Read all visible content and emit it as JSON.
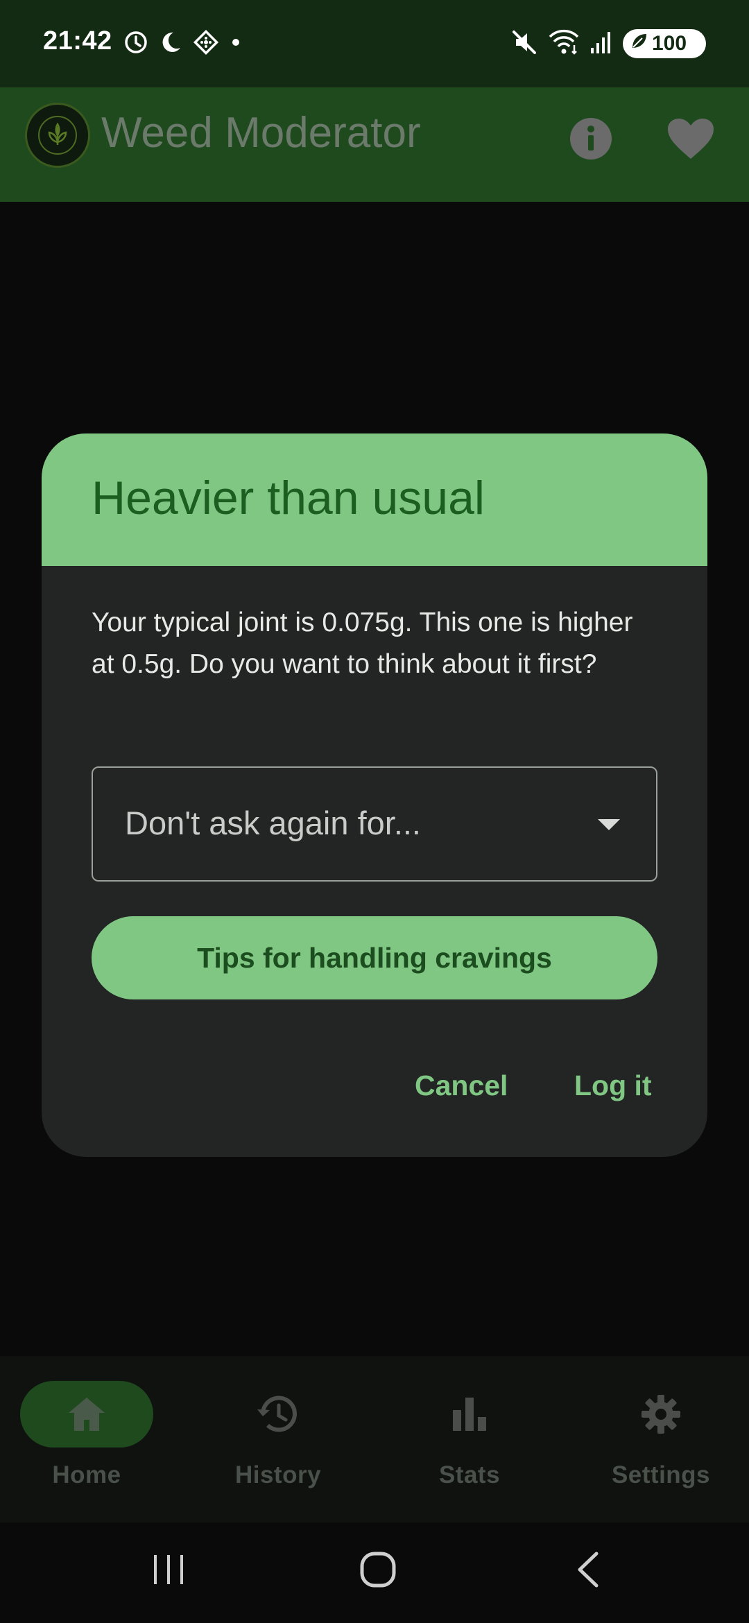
{
  "status_bar": {
    "time": "21:42",
    "battery": "100",
    "icons": [
      "alarm-icon",
      "do-not-disturb-moon-icon",
      "nfc-diamond-icon",
      "notification-dot-icon",
      "mute-icon",
      "wifi-icon",
      "signal-icon",
      "battery-saver-leaf-icon"
    ]
  },
  "app_bar": {
    "title": "Weed Moderator",
    "actions": [
      "info-icon",
      "heart-icon"
    ]
  },
  "dialog": {
    "title": "Heavier than usual",
    "message": "Your typical joint is 0.075g. This one is higher at 0.5g. Do you want to think about it first?",
    "dropdown_placeholder": "Don't ask again for...",
    "tips_button": "Tips for handling cravings",
    "cancel_button": "Cancel",
    "confirm_button": "Log it"
  },
  "bottom_nav": {
    "items": [
      {
        "label": "Home",
        "icon": "home-icon",
        "active": true
      },
      {
        "label": "History",
        "icon": "history-icon",
        "active": false
      },
      {
        "label": "Stats",
        "icon": "bar-chart-icon",
        "active": false
      },
      {
        "label": "Settings",
        "icon": "gear-icon",
        "active": false
      }
    ]
  },
  "colors": {
    "status_bar_bg": "#132b13",
    "app_bar_bg": "#1e4a1e",
    "accent": "#81c784",
    "dialog_bg": "#222524",
    "dialog_title": "#1b5e20",
    "nav_active_indicator": "#1e4a1e"
  }
}
